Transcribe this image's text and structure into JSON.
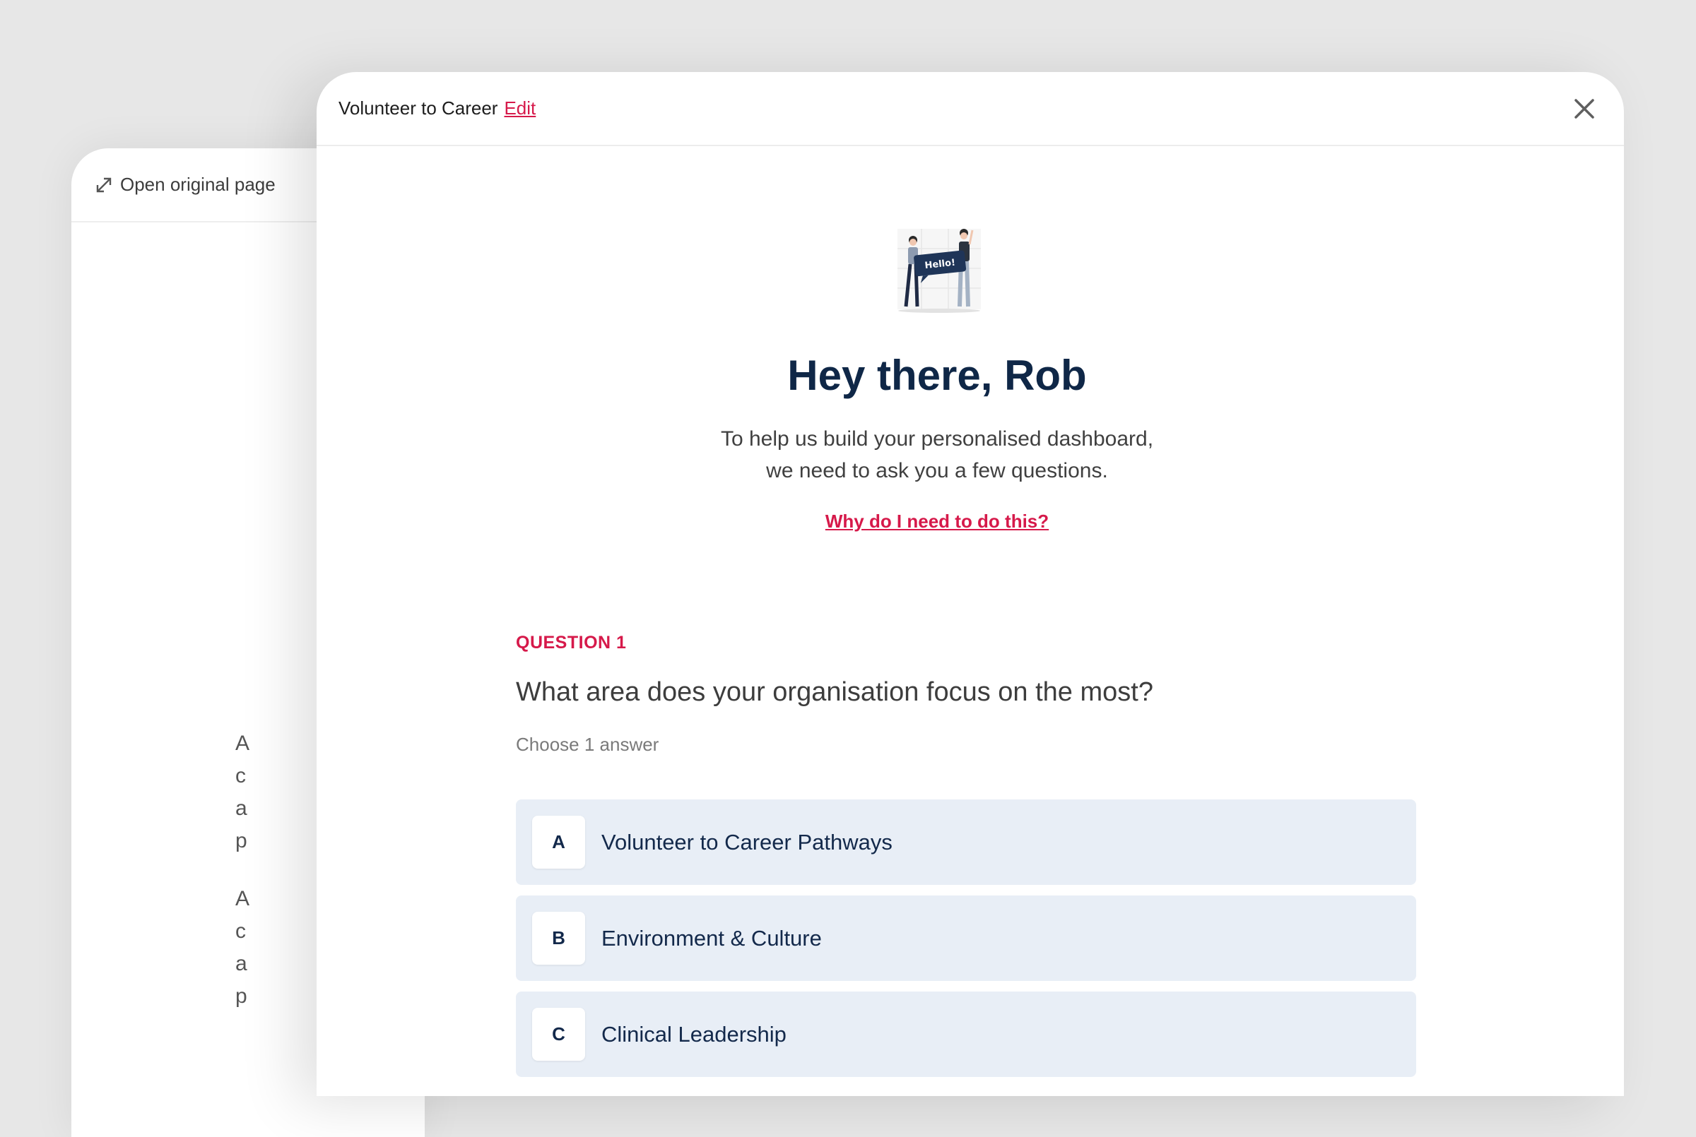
{
  "background_page": {
    "open_original_label": "Open original page",
    "text_blocks": [
      [
        "A",
        "c",
        "a",
        "p"
      ],
      [
        "A",
        "c",
        "a",
        "p"
      ]
    ]
  },
  "modal": {
    "title": "Volunteer to Career",
    "edit_label": "Edit",
    "close_icon": "close-icon"
  },
  "intro": {
    "illustration_text": "Hello!",
    "greeting": "Hey there, Rob",
    "line1": "To help us build your personalised dashboard,",
    "line2": "we need to ask you a few questions.",
    "why_link": "Why do I need to do this?"
  },
  "question": {
    "label": "QUESTION 1",
    "text": "What area does your organisation focus on the most?",
    "hint": "Choose 1 answer",
    "options": [
      {
        "key": "A",
        "label": "Volunteer to Career Pathways"
      },
      {
        "key": "B",
        "label": "Environment & Culture"
      },
      {
        "key": "C",
        "label": "Clinical Leadership"
      }
    ]
  },
  "colors": {
    "accent": "#d6194a",
    "heading": "#0f2747",
    "option_bg": "#e8eef6"
  }
}
